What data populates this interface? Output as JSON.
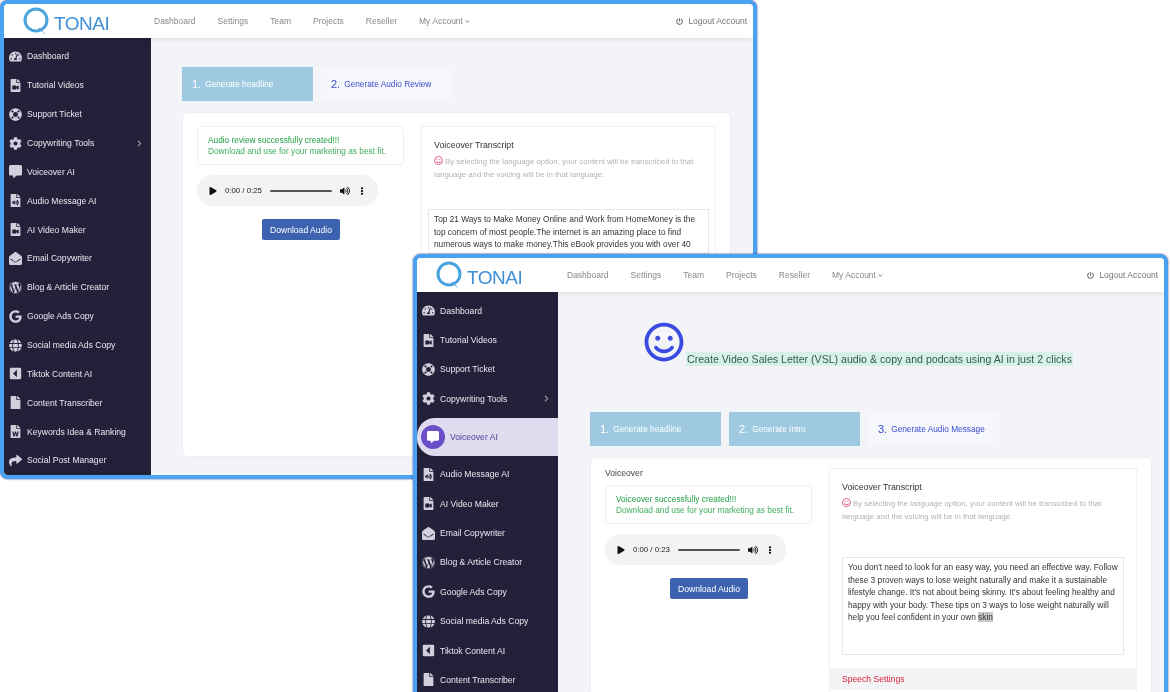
{
  "windows": [
    {
      "logo": "TONAI",
      "nav": [
        {
          "label": "Dashboard",
          "dropdown": false
        },
        {
          "label": "Settings",
          "dropdown": false
        },
        {
          "label": "Team",
          "dropdown": false
        },
        {
          "label": "Projects",
          "dropdown": false
        },
        {
          "label": "Reseller",
          "dropdown": false
        },
        {
          "label": "My Account",
          "dropdown": true
        }
      ],
      "logout": "Logout Account",
      "sidebar": [
        {
          "label": "Dashboard",
          "selected": false,
          "expandable": false
        },
        {
          "label": "Tutorial Videos",
          "selected": false,
          "expandable": false
        },
        {
          "label": "Support Ticket",
          "selected": false,
          "expandable": false
        },
        {
          "label": "Copywriting Tools",
          "selected": false,
          "expandable": true
        },
        {
          "label": "Voiceover AI",
          "selected": false,
          "expandable": false
        },
        {
          "label": "Audio Message AI",
          "selected": false,
          "expandable": false
        },
        {
          "label": "AI Video Maker",
          "selected": false,
          "expandable": false
        },
        {
          "label": "Email Copywriter",
          "selected": false,
          "expandable": false
        },
        {
          "label": "Blog & Article Creator",
          "selected": false,
          "expandable": false
        },
        {
          "label": "Google Ads Copy",
          "selected": false,
          "expandable": false
        },
        {
          "label": "Social media Ads Copy",
          "selected": false,
          "expandable": false
        },
        {
          "label": "Tiktok Content AI",
          "selected": false,
          "expandable": false
        },
        {
          "label": "Content Transcriber",
          "selected": false,
          "expandable": false
        },
        {
          "label": "Keywords Idea & Ranking",
          "selected": false,
          "expandable": false
        },
        {
          "label": "Social Post Manager",
          "selected": false,
          "expandable": false
        }
      ],
      "steps": [
        {
          "number": "1.",
          "label": "Generate headline",
          "done": true
        },
        {
          "number": "2.",
          "label": "Generate Audio Review",
          "done": false
        }
      ],
      "success": {
        "title": "Audio review successfully created!!!",
        "message": "Download and use for your marketing as best fit."
      },
      "player": {
        "time": "0:00 / 0:25"
      },
      "download_button": "Download Audio",
      "transcript": {
        "title": "Voiceover Transcript",
        "hint": "By selecting the language option, your content will be transcribed to that language and the voicing will be in that language.",
        "text": " Top 21 Ways to Make Money Online and Work from HomeMoney is the top concern of most people.The internet is an amazing place to find numerous ways to make money.This eBook provides you with over 40"
      }
    },
    {
      "logo": "TONAI",
      "nav": [
        {
          "label": "Dashboard",
          "dropdown": false
        },
        {
          "label": "Settings",
          "dropdown": false
        },
        {
          "label": "Team",
          "dropdown": false
        },
        {
          "label": "Projects",
          "dropdown": false
        },
        {
          "label": "Reseller",
          "dropdown": false
        },
        {
          "label": "My Account",
          "dropdown": true
        }
      ],
      "logout": "Logout Account",
      "sidebar": [
        {
          "label": "Dashboard",
          "selected": false,
          "expandable": false
        },
        {
          "label": "Tutorial Videos",
          "selected": false,
          "expandable": false
        },
        {
          "label": "Support Ticket",
          "selected": false,
          "expandable": false
        },
        {
          "label": "Copywriting Tools",
          "selected": false,
          "expandable": true
        },
        {
          "label": "Voiceover AI",
          "selected": true,
          "expandable": false
        },
        {
          "label": "Audio Message AI",
          "selected": false,
          "expandable": false
        },
        {
          "label": "AI Video Maker",
          "selected": false,
          "expandable": false
        },
        {
          "label": "Email Copywriter",
          "selected": false,
          "expandable": false
        },
        {
          "label": "Blog & Article Creator",
          "selected": false,
          "expandable": false
        },
        {
          "label": "Google Ads Copy",
          "selected": false,
          "expandable": false
        },
        {
          "label": "Social media Ads Copy",
          "selected": false,
          "expandable": false
        },
        {
          "label": "Tiktok Content AI",
          "selected": false,
          "expandable": false
        },
        {
          "label": "Content Transcriber",
          "selected": false,
          "expandable": false
        }
      ],
      "headline": "Create Video Sales Letter (VSL) audio & copy and podcats using AI in just 2 clicks",
      "steps": [
        {
          "number": "1.",
          "label": "Generate headline",
          "done": true
        },
        {
          "number": "2.",
          "label": "Generate Intro",
          "done": true
        },
        {
          "number": "3.",
          "label": "Generate Audio Message",
          "done": false
        }
      ],
      "section_label": "Voiceover",
      "success": {
        "title": "Voiceover successfully created!!!",
        "message": "Download and use for your marketing as best fit."
      },
      "player": {
        "time": "0:00 / 0:23"
      },
      "download_button": "Download Audio",
      "transcript": {
        "title": "Voiceover Transcript",
        "hint": "By selecting the language option, your content will be transcribed to that language and the voicing will be in that language.",
        "text": "   You don't need to look for an easy way, you need an effective way. Follow these 3 proven ways to lose weight naturally and make it a sustainable lifestyle change.  It's not about being skinny. It's about feeling healthy and happy with your body.  These tips on 3 ways to lose weight naturally will help you feel confident in your own ",
        "selected_text": "skin"
      },
      "speech_settings": "Speech Settings"
    }
  ]
}
